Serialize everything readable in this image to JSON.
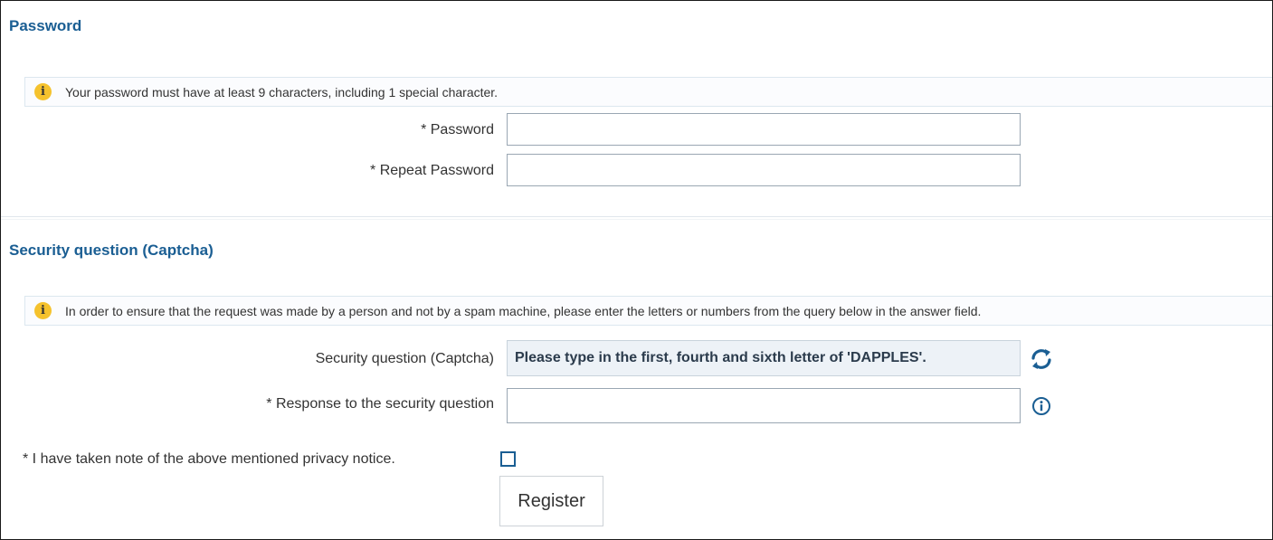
{
  "password_section": {
    "title": "Password",
    "notice": "Your password must have at least 9 characters, including 1 special character.",
    "password_label": "* Password",
    "password_value": "",
    "repeat_label": "* Repeat Password",
    "repeat_value": ""
  },
  "captcha_section": {
    "title": "Security question (Captcha)",
    "notice": "In order to ensure that the request was made by a person and not by a spam machine, please enter the letters or numbers from the query below in the answer field.",
    "question_label": "Security question (Captcha)",
    "question_text": "Please type in the first, fourth and sixth letter of 'DAPPLES'.",
    "response_label": "* Response to the security question",
    "response_value": ""
  },
  "privacy": {
    "label": "* I have taken note of the above mentioned privacy notice.",
    "checked": false
  },
  "actions": {
    "register_label": "Register"
  },
  "icons": {
    "notice_icon": "info-icon",
    "refresh_icon": "refresh-icon",
    "help_icon": "circle-info-icon"
  },
  "colors": {
    "heading": "#1a5e93",
    "notice_icon": "#f5c22d",
    "captcha_background": "#edf2f7"
  }
}
